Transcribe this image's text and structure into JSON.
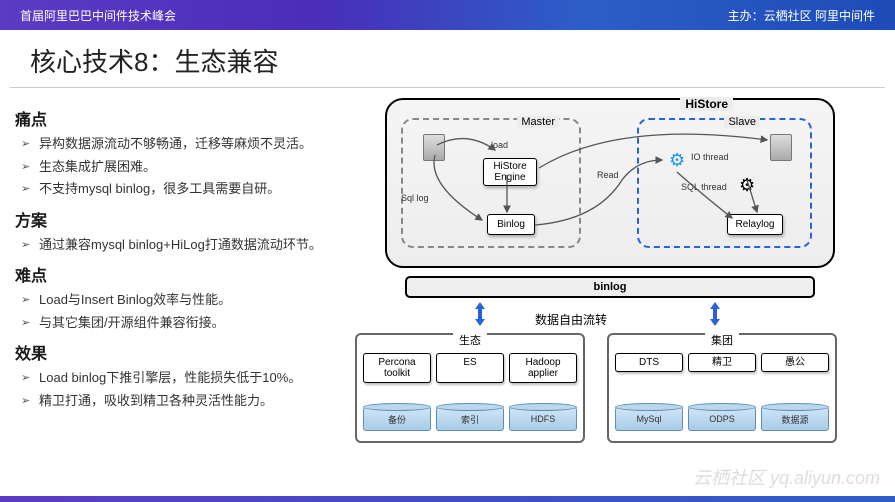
{
  "header": {
    "left": "首届阿里巴巴中间件技术峰会",
    "right": "主办：云栖社区 阿里中间件"
  },
  "title": "核心技术8：生态兼容",
  "sections": {
    "pain": {
      "h": "痛点",
      "items": [
        "异构数据源流动不够畅通，迁移等麻烦不灵活。",
        "生态集成扩展困难。",
        "不支持mysql binlog，很多工具需要自研。"
      ]
    },
    "plan": {
      "h": "方案",
      "items": [
        "通过兼容mysql binlog+HiLog打通数据流动环节。"
      ]
    },
    "hard": {
      "h": "难点",
      "items": [
        "Load与Insert Binlog效率与性能。",
        "与其它集团/开源组件兼容衔接。"
      ]
    },
    "effect": {
      "h": "效果",
      "items": [
        "Load binlog下推引擎层，性能损失低于10%。",
        "精卫打通，吸收到精卫各种灵活性能力。"
      ]
    }
  },
  "diagram": {
    "histore": "HiStore",
    "master": "Master",
    "slave": "Slave",
    "histore_engine": "HiStore\nEngine",
    "binlog_box": "Binlog",
    "relaylog_box": "Relaylog",
    "load_label": "load",
    "read_label": "Read",
    "sqllog_label": "Sql log",
    "io_thread": "IO thread",
    "sql_thread": "SQL thread",
    "binlog_bar": "binlog",
    "flow": "数据自由流转",
    "eco": {
      "label": "生态",
      "apps": [
        "Percona toolkit",
        "ES",
        "Hadoop applier"
      ],
      "cyls": [
        "备份",
        "索引",
        "HDFS"
      ]
    },
    "group": {
      "label": "集团",
      "apps": [
        "DTS",
        "精卫",
        "愚公"
      ],
      "cyls": [
        "MySql",
        "ODPS",
        "数据源"
      ]
    }
  },
  "watermark": "云栖社区 yq.aliyun.com"
}
